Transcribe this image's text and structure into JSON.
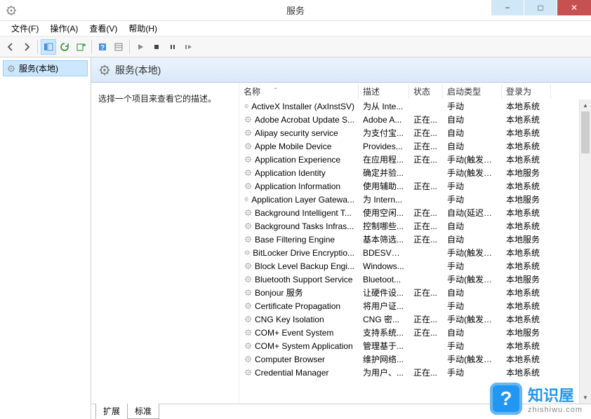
{
  "window": {
    "title": "服务"
  },
  "menu": {
    "file": "文件(F)",
    "action": "操作(A)",
    "view": "查看(V)",
    "help": "帮助(H)"
  },
  "nav": {
    "services_local": "服务(本地)"
  },
  "content": {
    "header": "服务(本地)",
    "description_prompt": "选择一个项目来查看它的描述。"
  },
  "columns": {
    "name": "名称",
    "description": "描述",
    "status": "状态",
    "startup": "启动类型",
    "logon": "登录为"
  },
  "sort_indicator": "ˆ",
  "tabs": {
    "extended": "扩展",
    "standard": "标准"
  },
  "services": [
    {
      "name": "ActiveX Installer (AxInstSV)",
      "desc": "为从 Inte...",
      "status": "",
      "startup": "手动",
      "logon": "本地系统"
    },
    {
      "name": "Adobe Acrobat Update S...",
      "desc": "Adobe A...",
      "status": "正在...",
      "startup": "自动",
      "logon": "本地系统"
    },
    {
      "name": "Alipay security service",
      "desc": "为支付宝...",
      "status": "正在...",
      "startup": "自动",
      "logon": "本地系统"
    },
    {
      "name": "Apple Mobile Device",
      "desc": "Provides...",
      "status": "正在...",
      "startup": "自动",
      "logon": "本地系统"
    },
    {
      "name": "Application Experience",
      "desc": "在应用程...",
      "status": "正在...",
      "startup": "手动(触发器...",
      "logon": "本地系统"
    },
    {
      "name": "Application Identity",
      "desc": "确定并验...",
      "status": "",
      "startup": "手动(触发器...",
      "logon": "本地服务"
    },
    {
      "name": "Application Information",
      "desc": "使用辅助...",
      "status": "正在...",
      "startup": "手动",
      "logon": "本地系统"
    },
    {
      "name": "Application Layer Gatewa...",
      "desc": "为 Intern...",
      "status": "",
      "startup": "手动",
      "logon": "本地服务"
    },
    {
      "name": "Background Intelligent T...",
      "desc": "使用空闲...",
      "status": "正在...",
      "startup": "自动(延迟启...",
      "logon": "本地系统"
    },
    {
      "name": "Background Tasks Infras...",
      "desc": "控制哪些...",
      "status": "正在...",
      "startup": "自动",
      "logon": "本地系统"
    },
    {
      "name": "Base Filtering Engine",
      "desc": "基本筛选...",
      "status": "正在...",
      "startup": "自动",
      "logon": "本地服务"
    },
    {
      "name": "BitLocker Drive Encryptio...",
      "desc": "BDESVC ...",
      "status": "",
      "startup": "手动(触发器...",
      "logon": "本地系统"
    },
    {
      "name": "Block Level Backup Engi...",
      "desc": "Windows...",
      "status": "",
      "startup": "手动",
      "logon": "本地系统"
    },
    {
      "name": "Bluetooth Support Service",
      "desc": "Bluetoot...",
      "status": "",
      "startup": "手动(触发器...",
      "logon": "本地服务"
    },
    {
      "name": "Bonjour 服务",
      "desc": "让硬件设...",
      "status": "正在...",
      "startup": "自动",
      "logon": "本地系统"
    },
    {
      "name": "Certificate Propagation",
      "desc": "将用户证...",
      "status": "",
      "startup": "手动",
      "logon": "本地系统"
    },
    {
      "name": "CNG Key Isolation",
      "desc": "CNG 密...",
      "status": "正在...",
      "startup": "手动(触发器...",
      "logon": "本地系统"
    },
    {
      "name": "COM+ Event System",
      "desc": "支持系统...",
      "status": "正在...",
      "startup": "自动",
      "logon": "本地服务"
    },
    {
      "name": "COM+ System Application",
      "desc": "管理基于...",
      "status": "",
      "startup": "手动",
      "logon": "本地系统"
    },
    {
      "name": "Computer Browser",
      "desc": "维护网络...",
      "status": "",
      "startup": "手动(触发器...",
      "logon": "本地系统"
    },
    {
      "name": "Credential Manager",
      "desc": "为用户、...",
      "status": "正在...",
      "startup": "手动",
      "logon": "本地系统"
    }
  ],
  "watermark": {
    "badge": "?",
    "text": "知识屋",
    "url": "zhishiwu.com"
  }
}
